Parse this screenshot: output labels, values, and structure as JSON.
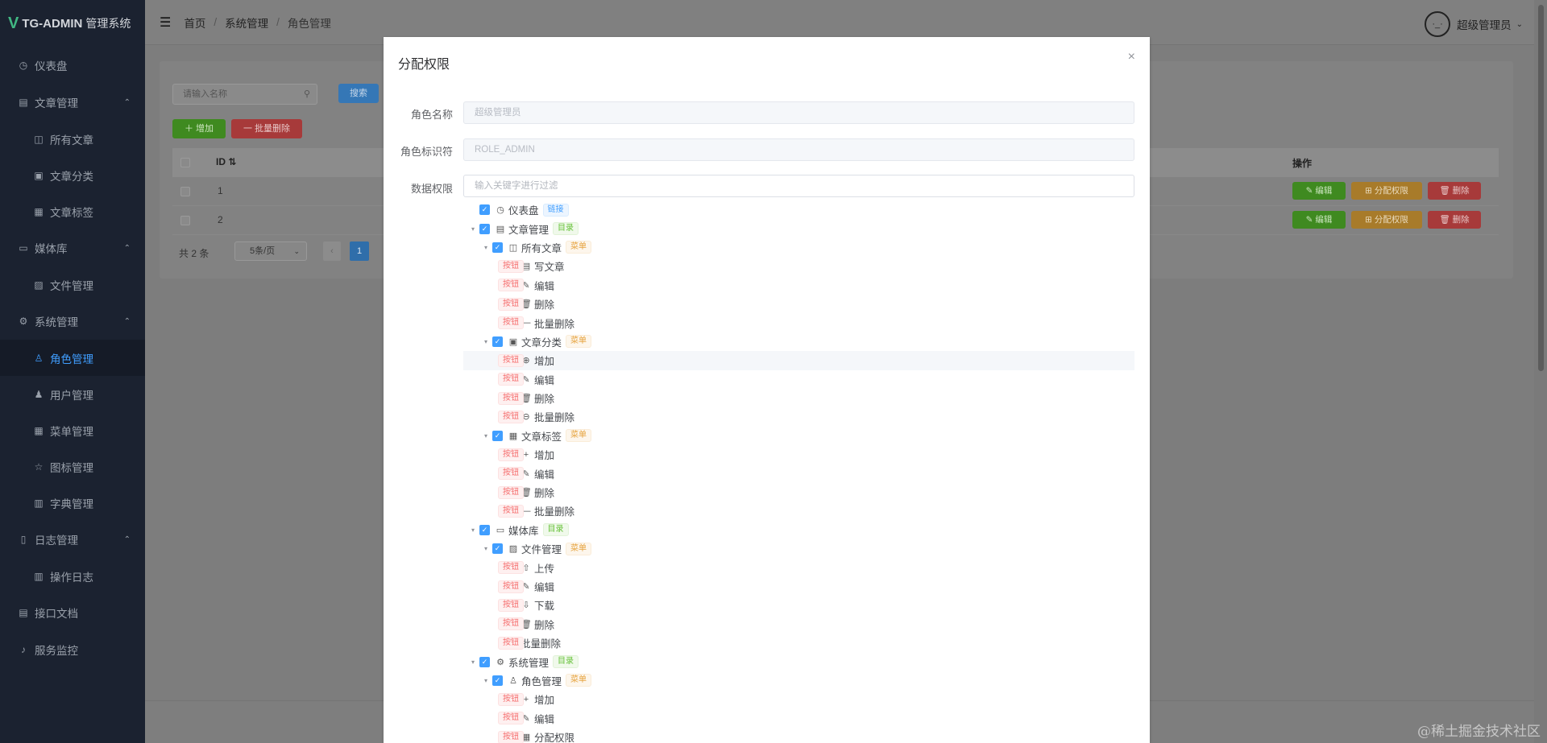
{
  "app": {
    "logo_mark": "V",
    "name": "TG-ADMIN",
    "subtitle": "管理系统"
  },
  "sidebar": {
    "items": [
      {
        "label": "仪表盘",
        "icon": "dashboard-icon",
        "glyph": "◷"
      },
      {
        "label": "文章管理",
        "icon": "document-icon",
        "glyph": "▤",
        "expanded": true
      },
      {
        "label": "所有文章",
        "icon": "book-icon",
        "glyph": "◫",
        "child": true
      },
      {
        "label": "文章分类",
        "icon": "clipboard-icon",
        "glyph": "▣",
        "child": true
      },
      {
        "label": "文章标签",
        "icon": "grid-icon",
        "glyph": "▦",
        "child": true
      },
      {
        "label": "媒体库",
        "icon": "folder-icon",
        "glyph": "▭",
        "expanded": true
      },
      {
        "label": "文件管理",
        "icon": "picture-icon",
        "glyph": "▨",
        "child": true
      },
      {
        "label": "系统管理",
        "icon": "gear-icon",
        "glyph": "⚙",
        "expanded": true
      },
      {
        "label": "角色管理",
        "icon": "user-icon",
        "glyph": "♙",
        "child": true,
        "active": true
      },
      {
        "label": "用户管理",
        "icon": "person-icon",
        "glyph": "♟",
        "child": true
      },
      {
        "label": "菜单管理",
        "icon": "menu-grid-icon",
        "glyph": "▦",
        "child": true
      },
      {
        "label": "图标管理",
        "icon": "star-icon",
        "glyph": "☆",
        "child": true
      },
      {
        "label": "字典管理",
        "icon": "bar-chart-icon",
        "glyph": "▥",
        "child": true
      },
      {
        "label": "日志管理",
        "icon": "log-icon",
        "glyph": "▯",
        "expanded": true
      },
      {
        "label": "操作日志",
        "icon": "chart-icon",
        "glyph": "▥",
        "child": true
      },
      {
        "label": "接口文档",
        "icon": "api-doc-icon",
        "glyph": "▤"
      },
      {
        "label": "服务监控",
        "icon": "bell-icon",
        "glyph": "♪"
      }
    ]
  },
  "header": {
    "breadcrumb": [
      "首页",
      "系统管理",
      "角色管理"
    ],
    "user_name": "超级管理员",
    "avatar_face": "·_·"
  },
  "list": {
    "search_placeholder": "请输入名称",
    "search_label": "搜索",
    "add_label": "＋ 增加",
    "batch_delete_label": "一 批量删除",
    "col_id": "ID",
    "col_op": "操作",
    "rows": [
      {
        "id": "1",
        "edit": "✎ 编辑",
        "assign": "⊞ 分配权限",
        "delete": "🗑 删除"
      },
      {
        "id": "2",
        "edit": "✎ 编辑",
        "assign": "⊞ 分配权限",
        "delete": "🗑 删除"
      }
    ],
    "total_text": "共 2 条",
    "page_size": "5条/页",
    "current_page": "1"
  },
  "dialog": {
    "title": "分配权限",
    "close": "×",
    "labels": {
      "role_name": "角色名称",
      "role_key": "角色标识符",
      "data_perm": "数据权限"
    },
    "role_name_value": "超级管理员",
    "role_key_value": "ROLE_ADMIN",
    "filter_placeholder": "输入关键字进行过滤",
    "tree": [
      {
        "level": 0,
        "caret": false,
        "glyph": "◷",
        "icon": "dashboard-icon",
        "label": "仪表盘",
        "tag": "链接",
        "type": "link"
      },
      {
        "level": 0,
        "caret": true,
        "glyph": "▤",
        "icon": "document-icon",
        "label": "文章管理",
        "tag": "目录",
        "type": "dir"
      },
      {
        "level": 1,
        "caret": true,
        "glyph": "◫",
        "icon": "book-icon",
        "label": "所有文章",
        "tag": "菜单",
        "type": "menu"
      },
      {
        "level": 2,
        "caret": false,
        "glyph": "▤",
        "icon": "write-icon",
        "label": "写文章",
        "tag": "按钮",
        "type": "btn"
      },
      {
        "level": 2,
        "caret": false,
        "glyph": "✎",
        "icon": "edit-icon",
        "label": "编辑",
        "tag": "按钮",
        "type": "btn"
      },
      {
        "level": 2,
        "caret": false,
        "glyph": "🗑",
        "icon": "trash-icon",
        "label": "删除",
        "tag": "按钮",
        "type": "btn"
      },
      {
        "level": 2,
        "caret": false,
        "glyph": "—",
        "icon": "minus-icon",
        "label": "批量删除",
        "tag": "按钮",
        "type": "btn"
      },
      {
        "level": 1,
        "caret": true,
        "glyph": "▣",
        "icon": "clipboard-icon",
        "label": "文章分类",
        "tag": "菜单",
        "type": "menu"
      },
      {
        "level": 2,
        "caret": false,
        "glyph": "⊕",
        "icon": "circle-plus-icon",
        "label": "增加",
        "tag": "按钮",
        "type": "btn",
        "highlight": true
      },
      {
        "level": 2,
        "caret": false,
        "glyph": "✎",
        "icon": "edit-icon",
        "label": "编辑",
        "tag": "按钮",
        "type": "btn"
      },
      {
        "level": 2,
        "caret": false,
        "glyph": "🗑",
        "icon": "trash-icon",
        "label": "删除",
        "tag": "按钮",
        "type": "btn"
      },
      {
        "level": 2,
        "caret": false,
        "glyph": "⊖",
        "icon": "circle-minus-icon",
        "label": "批量删除",
        "tag": "按钮",
        "type": "btn"
      },
      {
        "level": 1,
        "caret": true,
        "glyph": "▦",
        "icon": "grid-icon",
        "label": "文章标签",
        "tag": "菜单",
        "type": "menu"
      },
      {
        "level": 2,
        "caret": false,
        "glyph": "+",
        "icon": "plus-icon",
        "label": "增加",
        "tag": "按钮",
        "type": "btn"
      },
      {
        "level": 2,
        "caret": false,
        "glyph": "✎",
        "icon": "edit-icon",
        "label": "编辑",
        "tag": "按钮",
        "type": "btn"
      },
      {
        "level": 2,
        "caret": false,
        "glyph": "🗑",
        "icon": "trash-icon",
        "label": "删除",
        "tag": "按钮",
        "type": "btn"
      },
      {
        "level": 2,
        "caret": false,
        "glyph": "—",
        "icon": "minus-icon",
        "label": "批量删除",
        "tag": "按钮",
        "type": "btn"
      },
      {
        "level": 0,
        "caret": true,
        "glyph": "▭",
        "icon": "folder-icon",
        "label": "媒体库",
        "tag": "目录",
        "type": "dir"
      },
      {
        "level": 1,
        "caret": true,
        "glyph": "▨",
        "icon": "picture-icon",
        "label": "文件管理",
        "tag": "菜单",
        "type": "menu"
      },
      {
        "level": 2,
        "caret": false,
        "glyph": "⇧",
        "icon": "upload-icon",
        "label": "上传",
        "tag": "按钮",
        "type": "btn"
      },
      {
        "level": 2,
        "caret": false,
        "glyph": "✎",
        "icon": "edit-icon",
        "label": "编辑",
        "tag": "按钮",
        "type": "btn"
      },
      {
        "level": 2,
        "caret": false,
        "glyph": "⇩",
        "icon": "download-icon",
        "label": "下载",
        "tag": "按钮",
        "type": "btn"
      },
      {
        "level": 2,
        "caret": false,
        "glyph": "🗑",
        "icon": "trash-icon",
        "label": "删除",
        "tag": "按钮",
        "type": "btn"
      },
      {
        "level": 2,
        "caret": false,
        "glyph": "",
        "icon": "none",
        "label": "批量删除",
        "tag": "按钮",
        "type": "btn"
      },
      {
        "level": 0,
        "caret": true,
        "glyph": "⚙",
        "icon": "gear-icon",
        "label": "系统管理",
        "tag": "目录",
        "type": "dir"
      },
      {
        "level": 1,
        "caret": true,
        "glyph": "♙",
        "icon": "user-icon",
        "label": "角色管理",
        "tag": "菜单",
        "type": "menu"
      },
      {
        "level": 2,
        "caret": false,
        "glyph": "+",
        "icon": "plus-icon",
        "label": "增加",
        "tag": "按钮",
        "type": "btn"
      },
      {
        "level": 2,
        "caret": false,
        "glyph": "✎",
        "icon": "edit-icon",
        "label": "编辑",
        "tag": "按钮",
        "type": "btn"
      },
      {
        "level": 2,
        "caret": false,
        "glyph": "▦",
        "icon": "grid-icon",
        "label": "分配权限",
        "tag": "按钮",
        "type": "btn"
      }
    ]
  },
  "watermark": "@稀土掘金技术社区",
  "colors": {
    "primary": "#409eff",
    "sidebar_bg": "#1b2230",
    "success": "#67c23a",
    "warning": "#e6a23c",
    "danger": "#f56c6c"
  }
}
